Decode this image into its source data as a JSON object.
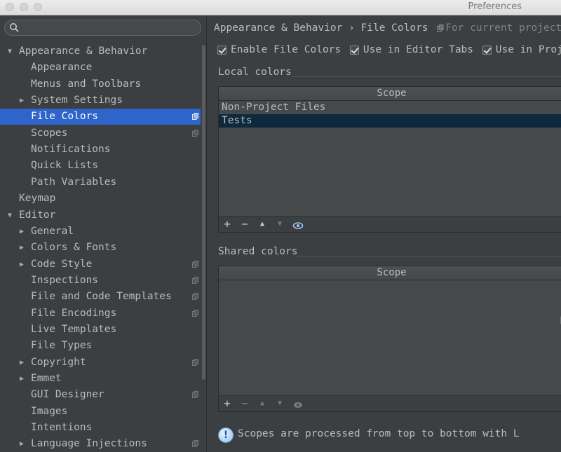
{
  "window": {
    "title": "Preferences"
  },
  "search": {
    "placeholder": ""
  },
  "sidebar": {
    "items": [
      {
        "label": "Appearance & Behavior",
        "level": 0,
        "arrow": "▼"
      },
      {
        "label": "Appearance",
        "level": 1,
        "arrow": ""
      },
      {
        "label": "Menus and Toolbars",
        "level": 1,
        "arrow": ""
      },
      {
        "label": "System Settings",
        "level": 1,
        "arrow": "▶"
      },
      {
        "label": "File Colors",
        "level": 1,
        "arrow": "",
        "selected": true,
        "project": true
      },
      {
        "label": "Scopes",
        "level": 1,
        "arrow": "",
        "project": true
      },
      {
        "label": "Notifications",
        "level": 1,
        "arrow": ""
      },
      {
        "label": "Quick Lists",
        "level": 1,
        "arrow": ""
      },
      {
        "label": "Path Variables",
        "level": 1,
        "arrow": ""
      },
      {
        "label": "Keymap",
        "level": 0,
        "arrow": ""
      },
      {
        "label": "Editor",
        "level": 0,
        "arrow": "▼"
      },
      {
        "label": "General",
        "level": 1,
        "arrow": "▶"
      },
      {
        "label": "Colors & Fonts",
        "level": 1,
        "arrow": "▶"
      },
      {
        "label": "Code Style",
        "level": 1,
        "arrow": "▶",
        "project": true
      },
      {
        "label": "Inspections",
        "level": 1,
        "arrow": "",
        "project": true
      },
      {
        "label": "File and Code Templates",
        "level": 1,
        "arrow": "",
        "project": true
      },
      {
        "label": "File Encodings",
        "level": 1,
        "arrow": "",
        "project": true
      },
      {
        "label": "Live Templates",
        "level": 1,
        "arrow": ""
      },
      {
        "label": "File Types",
        "level": 1,
        "arrow": ""
      },
      {
        "label": "Copyright",
        "level": 1,
        "arrow": "▶",
        "project": true
      },
      {
        "label": "Emmet",
        "level": 1,
        "arrow": "▶"
      },
      {
        "label": "GUI Designer",
        "level": 1,
        "arrow": "",
        "project": true
      },
      {
        "label": "Images",
        "level": 1,
        "arrow": ""
      },
      {
        "label": "Intentions",
        "level": 1,
        "arrow": ""
      },
      {
        "label": "Language Injections",
        "level": 1,
        "arrow": "▶",
        "project": true
      }
    ]
  },
  "main": {
    "breadcrumb": "Appearance & Behavior › File Colors",
    "for_project": "For current project",
    "checkboxes": {
      "enable_file_colors": "Enable File Colors",
      "use_in_editor_tabs": "Use in Editor Tabs",
      "use_in_project_view": "Use in Project V"
    },
    "local_colors": {
      "label": "Local colors",
      "header": "Scope",
      "rows": [
        "Non-Project Files",
        "Tests"
      ]
    },
    "shared_colors": {
      "label": "Shared colors",
      "header": "Scope",
      "empty_text": "N"
    },
    "info": "Scopes are processed from top to bottom with L"
  },
  "colors": {
    "selection": "#2f65ca",
    "row_selection": "#0d293e",
    "background": "#3c3f41"
  }
}
